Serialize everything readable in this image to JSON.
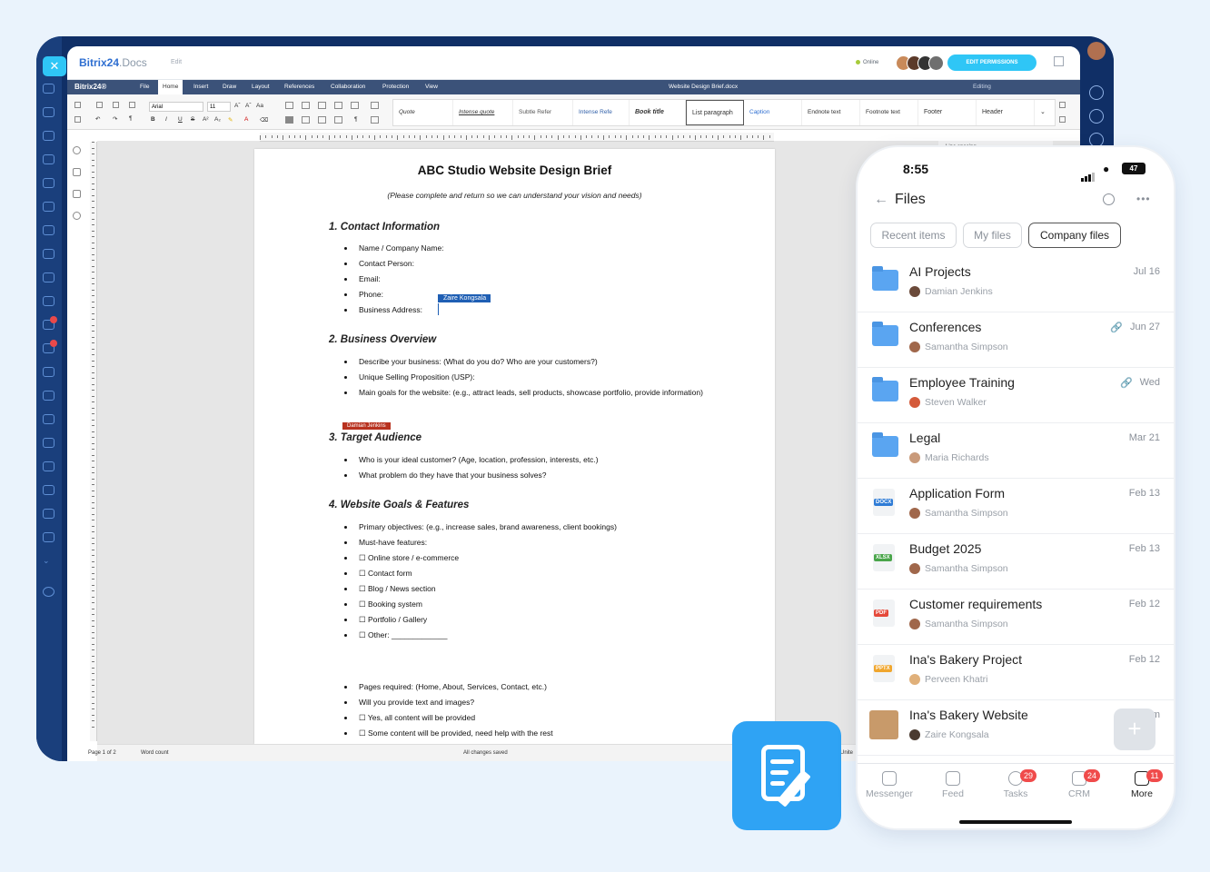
{
  "app": {
    "logo": "Bitrix24",
    "logo_suffix": ".Docs",
    "mode": "Edit",
    "online": "Online",
    "edit_permissions": "EDIT PERMISSIONS"
  },
  "menu": {
    "brand": "Bitrix24®",
    "items": [
      "File",
      "Home",
      "Insert",
      "Draw",
      "Layout",
      "References",
      "Collaboration",
      "Protection",
      "View"
    ],
    "active": "Home",
    "doc_name": "Website Design Brief.docx",
    "editing": "Editing"
  },
  "ribbon": {
    "font": "Arial",
    "size": "11",
    "styles": [
      "Quote",
      "Intense quote",
      "Subtle Refer",
      "Intense Refe",
      "Book title",
      "List paragraph",
      "Caption",
      "Endnote text",
      "Footnote text",
      "Footer",
      "Header"
    ],
    "panel_label": "Line spacing"
  },
  "document": {
    "title": "ABC Studio Website Design Brief",
    "subtitle": "(Please complete and return so we can understand your vision and needs)",
    "sections": [
      {
        "heading": "1. Contact Information",
        "items": [
          "Name / Company Name:",
          "Contact Person:",
          "Email:",
          "Phone:",
          "Business Address:"
        ]
      },
      {
        "heading": "2. Business Overview",
        "items": [
          "Describe your business: (What do you do? Who are your customers?)",
          "Unique Selling Proposition (USP):",
          "Main goals for the website: (e.g., attract leads, sell products, showcase portfolio, provide information)"
        ]
      },
      {
        "heading": "3. Target Audience",
        "items": [
          "Who is your ideal customer? (Age, location, profession, interests, etc.)",
          "What problem do they have that your business solves?"
        ]
      },
      {
        "heading": "4. Website Goals & Features",
        "items": [
          "Primary objectives: (e.g., increase sales, brand awareness, client bookings)",
          "Must-have features:",
          "☐ Online store / e-commerce",
          "☐ Contact form",
          "☐ Blog / News section",
          "☐ Booking system",
          "☐ Portfolio / Gallery",
          "☐ Other: _____________"
        ]
      },
      {
        "heading": "",
        "items": [
          "Pages required: (Home, About, Services, Contact, etc.)",
          "Will you provide text and images?",
          "☐ Yes, all content will be provided",
          "☐ Some content will be provided, need help with the rest"
        ]
      }
    ],
    "cursors": [
      {
        "name": "Zaire Kongsala",
        "color": "#1f5fb4"
      },
      {
        "name": "Damian Jenkins",
        "color": "#b8321f"
      }
    ]
  },
  "status": {
    "page": "Page 1 of 2",
    "word_count": "Word count",
    "saved": "All changes saved",
    "lang": "Unite"
  },
  "phone": {
    "time": "8:55",
    "battery": "47",
    "title": "Files",
    "chips": [
      "Recent items",
      "My files",
      "Company files"
    ],
    "selected_chip": "Company files",
    "files": [
      {
        "name": "AI Projects",
        "user": "Damian Jenkins",
        "date": "Jul 16",
        "kind": "folder",
        "shared": false
      },
      {
        "name": "Conferences",
        "user": "Samantha Simpson",
        "date": "Jun 27",
        "kind": "folder",
        "shared": true
      },
      {
        "name": "Employee Training",
        "user": "Steven Walker",
        "date": "Wed",
        "kind": "folder",
        "shared": true
      },
      {
        "name": "Legal",
        "user": "Maria Richards",
        "date": "Mar 21",
        "kind": "folder",
        "shared": false
      },
      {
        "name": "Application Form",
        "user": "Samantha Simpson",
        "date": "Feb 13",
        "kind": "DOCX",
        "color": "#2f7cd6",
        "shared": false
      },
      {
        "name": "Budget 2025",
        "user": "Samantha Simpson",
        "date": "Feb 13",
        "kind": "XLSX",
        "color": "#49a54a",
        "shared": false
      },
      {
        "name": "Customer requirements",
        "user": "Samantha Simpson",
        "date": "Feb 12",
        "kind": "PDF",
        "color": "#e5493a",
        "shared": false
      },
      {
        "name": "Ina's Bakery Project",
        "user": "Perveen Khatri",
        "date": "Feb 12",
        "kind": "PPTX",
        "color": "#f0a62e",
        "shared": false
      },
      {
        "name": "Ina's Bakery Website",
        "user": "Zaire Kongsala",
        "date": "m",
        "kind": "image",
        "shared": false
      }
    ],
    "tabs": [
      {
        "label": "Messenger",
        "badge": ""
      },
      {
        "label": "Feed",
        "badge": ""
      },
      {
        "label": "Tasks",
        "badge": "29"
      },
      {
        "label": "CRM",
        "badge": "24"
      },
      {
        "label": "More",
        "badge": "11"
      }
    ],
    "active_tab": "More"
  },
  "colors": {
    "accent": "#2fc6f6",
    "frame": "#102f66",
    "menubar": "#3b5279",
    "folder": "#5aa5f1"
  }
}
